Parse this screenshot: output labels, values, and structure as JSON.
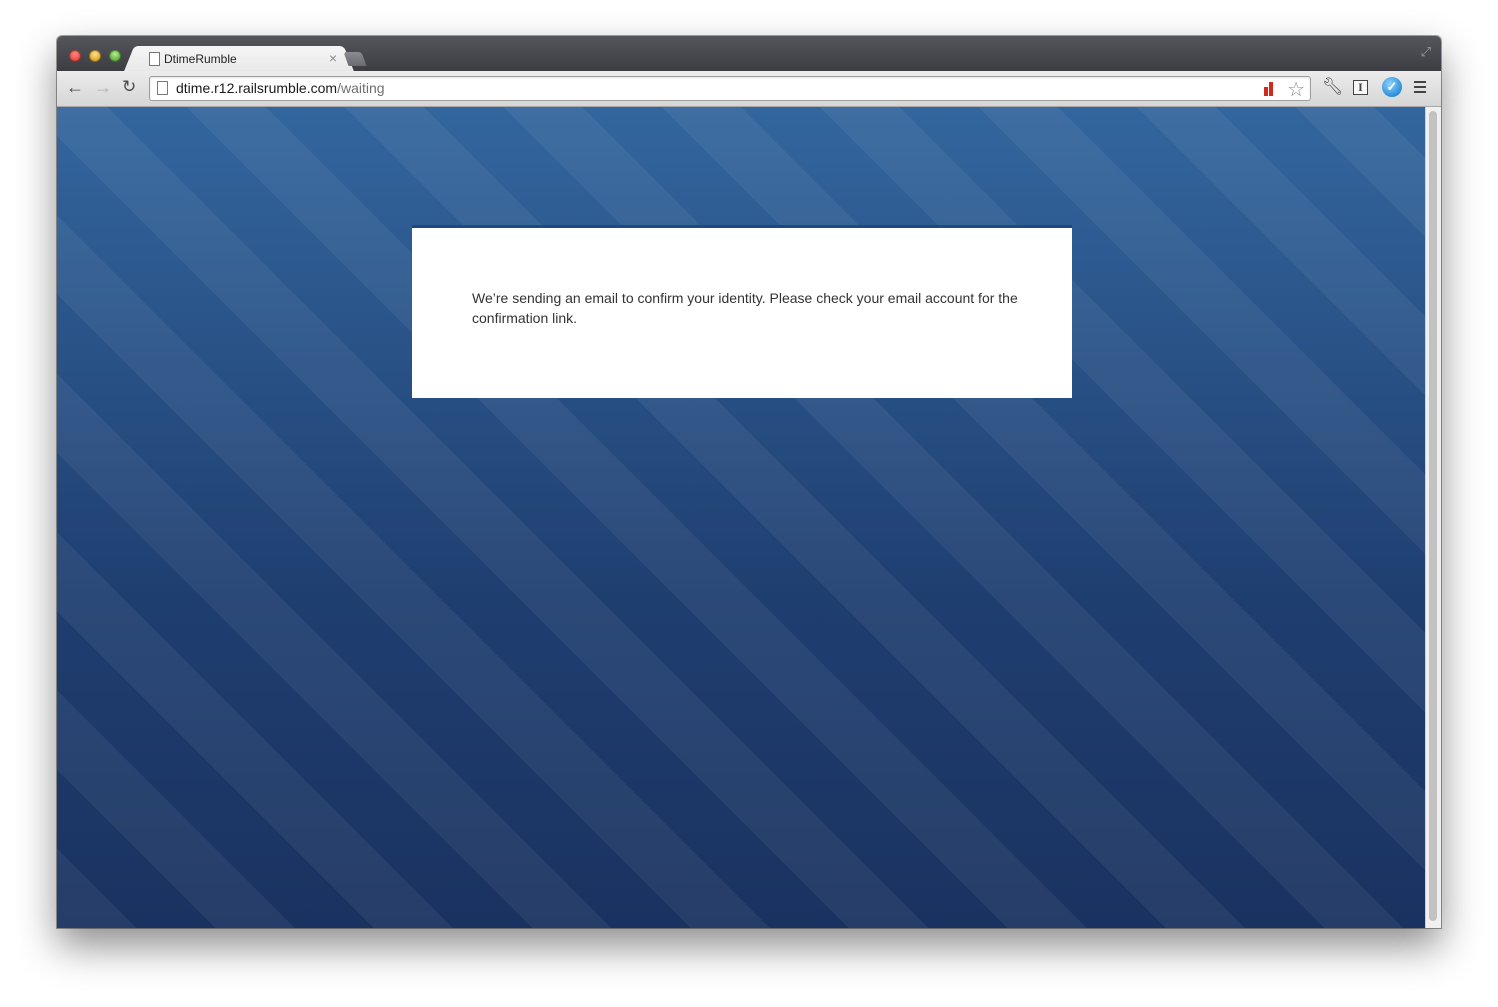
{
  "browser": {
    "tab": {
      "title": "DtimeRumble",
      "close_glyph": "×"
    },
    "address_bar": {
      "host": "dtime.r12.railsrumble.com",
      "path": "/waiting"
    },
    "icons": [
      "back-icon",
      "forward-icon",
      "reload-icon",
      "page-icon",
      "bar-chart-icon",
      "star-icon",
      "wrench-icon",
      "extension-i-icon",
      "extension-v-icon",
      "menu-icon",
      "fullscreen-icon"
    ]
  },
  "page": {
    "message": "We’re sending an email to confirm your identity. Please check your email account for the confirmation link."
  },
  "colors": {
    "background_top": "#33669e",
    "background_bottom": "#1a3260",
    "card": "#ffffff",
    "text": "#333333"
  }
}
